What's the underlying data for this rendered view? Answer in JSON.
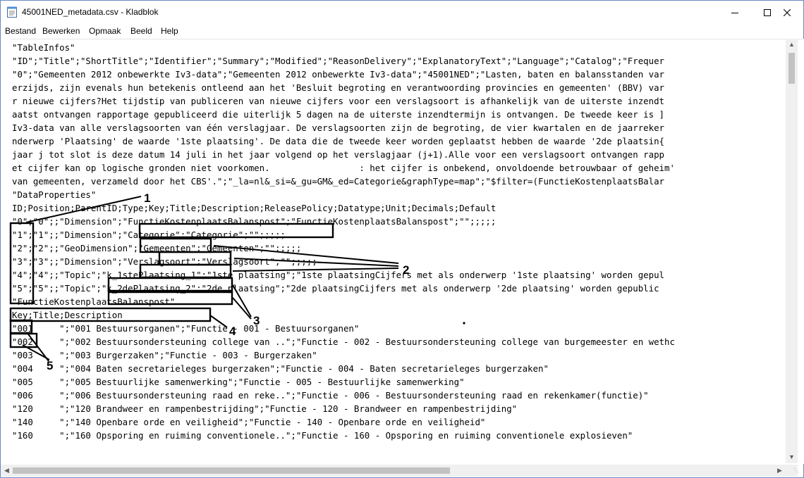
{
  "window": {
    "title": "45001NED_metadata.csv - Kladblok",
    "minimize_icon": "minimize-icon",
    "maximize_icon": "maximize-icon",
    "close_icon": "close-icon"
  },
  "menu": [
    "Bestand",
    "Bewerken",
    "Opmaak",
    "Beeld",
    "Help"
  ],
  "lines": [
    "\"TableInfos\"",
    "\"ID\";\"Title\";\"ShortTitle\";\"Identifier\";\"Summary\";\"Modified\";\"ReasonDelivery\";\"ExplanatoryText\";\"Language\";\"Catalog\";\"Frequer",
    "\"0\";\"Gemeenten 2012 onbewerkte Iv3-data\";\"Gemeenten 2012 onbewerkte Iv3-data\";\"45001NED\";\"Lasten, baten en balansstanden var",
    "erzijds, zijn evenals hun betekenis ontleend aan het 'Besluit begroting en verantwoording provincies en gemeenten' (BBV) var",
    "r nieuwe cijfers?Het tijdstip van publiceren van nieuwe cijfers voor een verslagsoort is afhankelijk van de uiterste inzendt",
    "aatst ontvangen rapportage gepubliceerd die uiterlijk 5 dagen na de uiterste inzendtermijn is ontvangen. De tweede keer is ]",
    "Iv3-data van alle verslagsoorten van één verslagjaar. De verslagsoorten zijn de begroting, de vier kwartalen en de jaarreker",
    "nderwerp 'Plaatsing' de waarde '1ste plaatsing'. De data die de tweede keer worden geplaatst hebben de waarde '2de plaatsin{",
    "jaar j tot slot is deze datum 14 juli in het jaar volgend op het verslagjaar (j+1).Alle voor een verslagsoort ontvangen rapp",
    "et cijfer kan op logische gronden niet voorkomen.                 : het cijfer is onbekend, onvoldoende betrouwbaar of geheim'",
    "van gemeenten, verzameld door het CBS'.\";\"_la=nl&_si=&_gu=GM&_ed=Categorie&graphType=map\";\"$filter=(FunctieKostenplaatsBalar",
    "\"DataProperties\"",
    "ID;Position;ParentID;Type;Key;Title;Description;ReleasePolicy;Datatype;Unit;Decimals;Default",
    "\"0\";\"0\";;\"Dimension\";\"FunctieKostenplaatsBalanspost\";\"FunctieKostenplaatsBalanspost\";\"\";;;;;",
    "\"1\";\"1\";;\"Dimension\";\"Categorie\";\"Categorie\";\"\";;;;;",
    "\"2\";\"2\";;\"GeoDimension\";\"Gemeenten\";\"Gemeenten\";\"\";;;;;",
    "\"3\";\"3\";;\"Dimension\";\"Verslagsoort\";\"Verslagsoort\";\"\";;;;;",
    "\"4\";\"4\";;\"Topic\";\"k_1stePlaatsing_1\";\"1ste plaatsing\";\"1ste plaatsingCijfers met als onderwerp '1ste plaatsing' worden gepul",
    "\"5\";\"5\";;\"Topic\";\"k_2dePlaatsing_2\";\"2de plaatsing\";\"2de plaatsingCijfers met als onderwerp '2de plaatsing' worden gepublic",
    "\"FunctieKostenplaatsBalanspost\"",
    "Key;Title;Description",
    "\"001     \";\"001 Bestuursorganen\";\"Functie - 001 - Bestuursorganen\"",
    "\"002     \";\"002 Bestuursondersteuning college van ..\";\"Functie - 002 - Bestuursondersteuning college van burgemeester en wethc",
    "\"003     \";\"003 Burgerzaken\";\"Functie - 003 - Burgerzaken\"",
    "\"004     \";\"004 Baten secretarieleges burgerzaken\";\"Functie - 004 - Baten secretarieleges burgerzaken\"",
    "\"005     \";\"005 Bestuurlijke samenwerking\";\"Functie - 005 - Bestuurlijke samenwerking\"",
    "\"006     \";\"006 Bestuursondersteuning raad en reke..\";\"Functie - 006 - Bestuursondersteuning raad en rekenkamer(functie)\"",
    "\"120     \";\"120 Brandweer en rampenbestrijding\";\"Functie - 120 - Brandweer en rampenbestrijding\"",
    "\"140     \";\"140 Openbare orde en veiligheid\";\"Functie - 140 - Openbare orde en veiligheid\"",
    "\"160     \";\"160 Opsporing en ruiming conventionele..\";\"Functie - 160 - Opsporing en ruiming conventionele explosieven\""
  ],
  "annotations": [
    "1",
    "2",
    "3",
    "4",
    "5"
  ],
  "scrollbars": {
    "up_icon": "scroll-up-arrow-icon",
    "down_icon": "scroll-down-arrow-icon",
    "left_icon": "scroll-left-arrow-icon",
    "right_icon": "scroll-right-arrow-icon"
  }
}
